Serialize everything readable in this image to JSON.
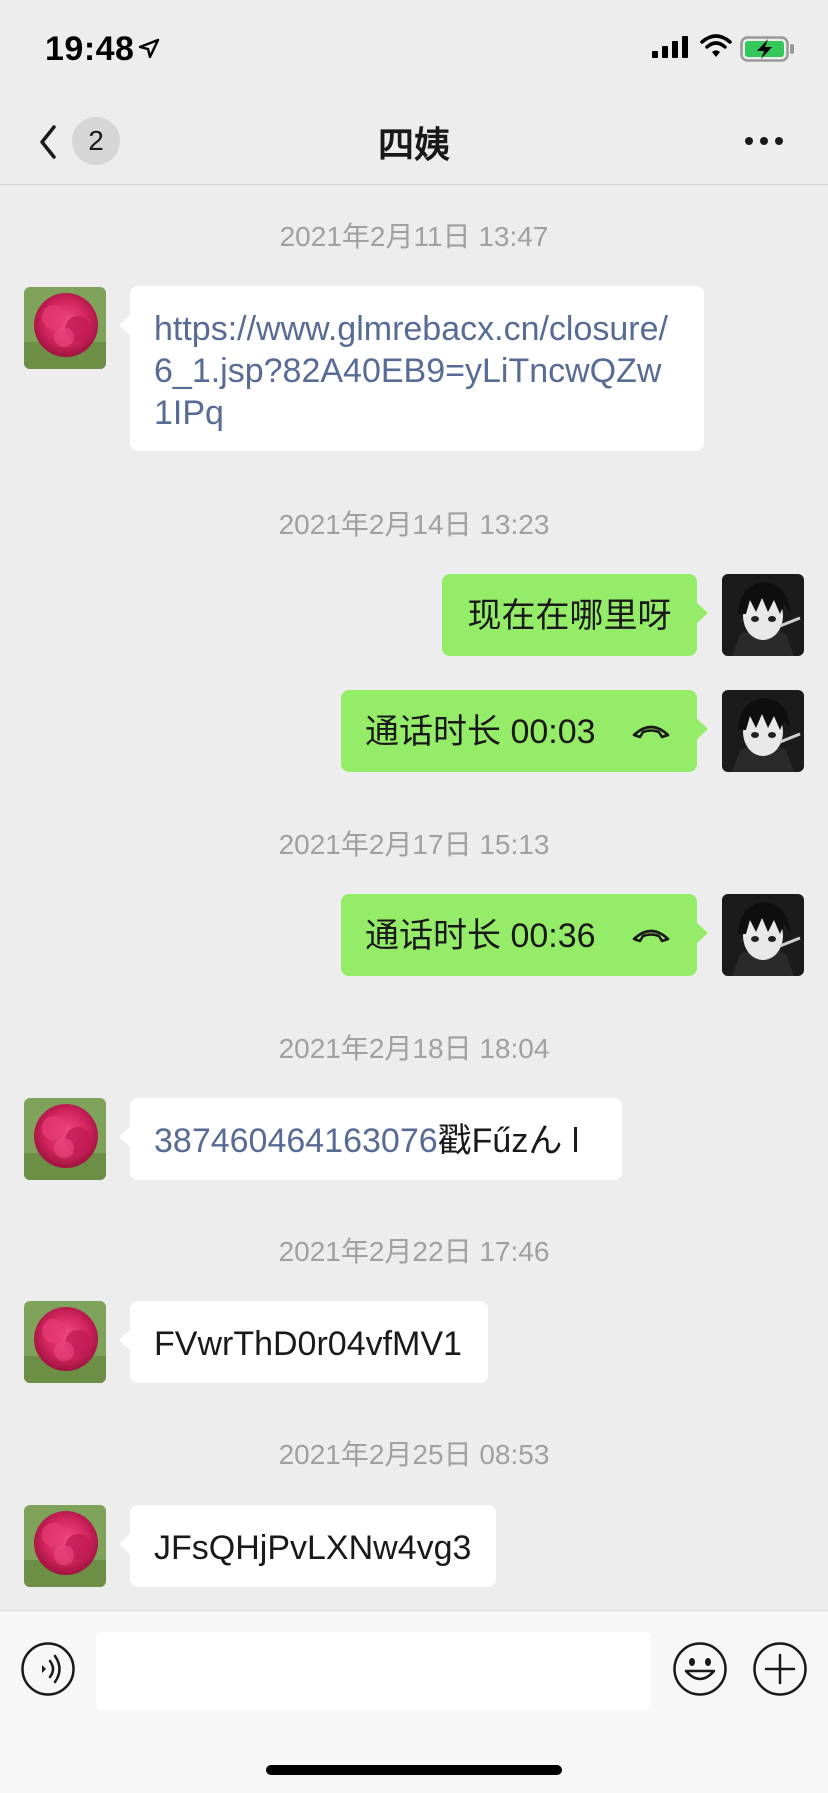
{
  "status_bar": {
    "time": "19:48"
  },
  "header": {
    "unread_count": "2",
    "title": "四姨"
  },
  "colors": {
    "incoming_bubble": "#ffffff",
    "outgoing_bubble": "#95ec69",
    "link": "#576b95",
    "background": "#ededed"
  },
  "avatars": {
    "contact": "peony-flower-avatar",
    "self": "anime-character-avatar"
  },
  "messages": [
    {
      "timestamp": "2021年2月11日 13:47",
      "direction": "in",
      "link_text": "https://www.glmrebacx.cn/closure/6_1.jsp?82A40EB9=yLiTncwQZw1IPq"
    },
    {
      "timestamp": "2021年2月14日 13:23",
      "direction": "out",
      "text": "现在在哪里呀"
    },
    {
      "direction": "out",
      "type": "call",
      "text": "通话时长 00:03"
    },
    {
      "timestamp": "2021年2月17日 15:13",
      "direction": "out",
      "type": "call",
      "text": "通话时长 00:36"
    },
    {
      "timestamp": "2021年2月18日 18:04",
      "direction": "in",
      "link_text": "387460464163076",
      "text": "戳Fűzん l"
    },
    {
      "timestamp": "2021年2月22日 17:46",
      "direction": "in",
      "text": "FVwrThD0r04vfMV1"
    },
    {
      "timestamp": "2021年2月25日 08:53",
      "direction": "in",
      "text": "JFsQHjPvLXNw4vg3"
    }
  ],
  "input_bar": {
    "placeholder": ""
  }
}
